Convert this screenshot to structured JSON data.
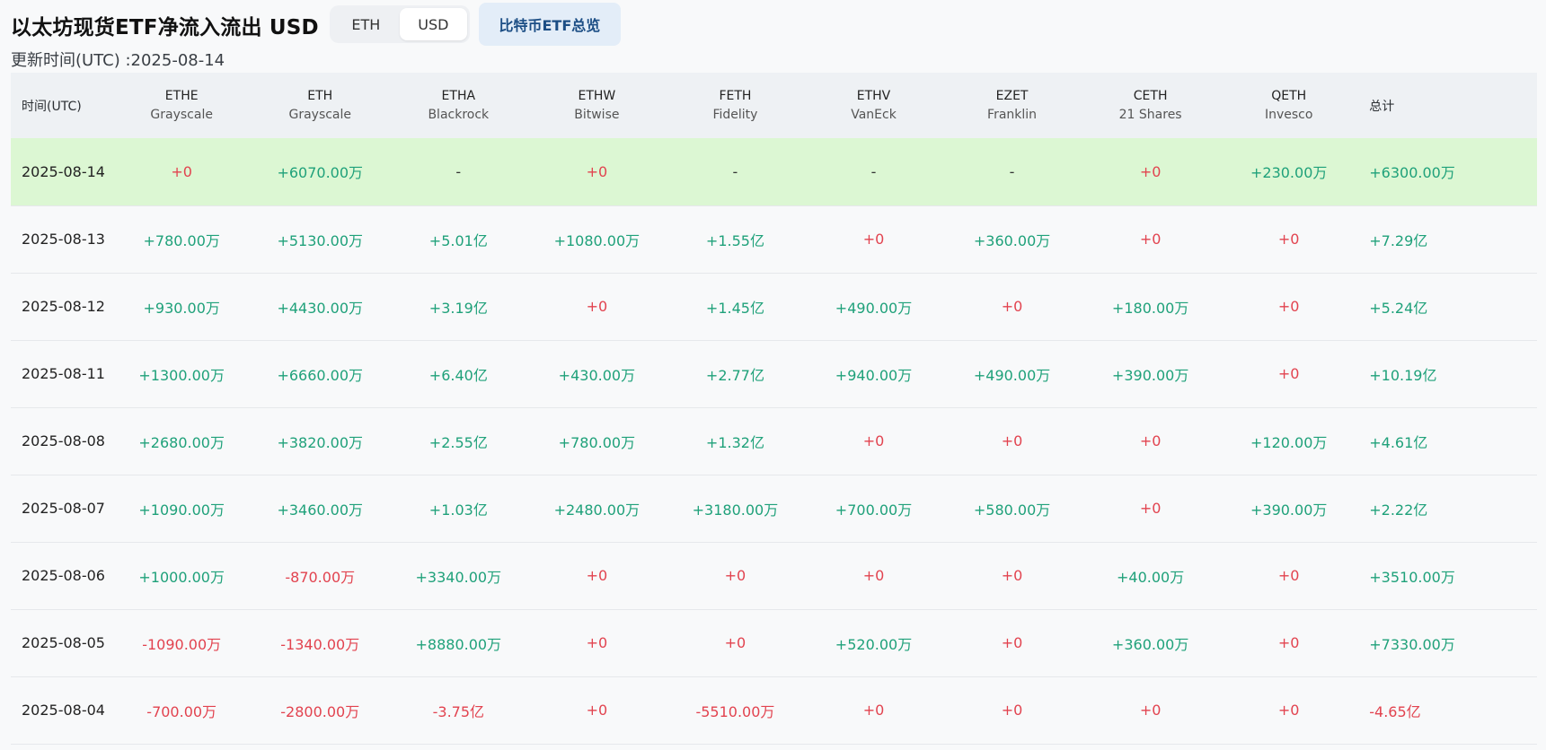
{
  "header": {
    "title": "以太坊现货ETF净流入流出 USD",
    "toggle": [
      "ETH",
      "USD"
    ],
    "active": "USD",
    "btc_overview_label": "比特币ETF总览"
  },
  "updated": "更新时间(UTC) :2025-08-14",
  "table": {
    "date_header": "时间(UTC)",
    "total_header": "总计",
    "columns": [
      {
        "code": "ETHE",
        "issuer": "Grayscale"
      },
      {
        "code": "ETH",
        "issuer": "Grayscale"
      },
      {
        "code": "ETHA",
        "issuer": "Blackrock"
      },
      {
        "code": "ETHW",
        "issuer": "Bitwise"
      },
      {
        "code": "FETH",
        "issuer": "Fidelity"
      },
      {
        "code": "ETHV",
        "issuer": "VanEck"
      },
      {
        "code": "EZET",
        "issuer": "Franklin"
      },
      {
        "code": "CETH",
        "issuer": "21 Shares"
      },
      {
        "code": "QETH",
        "issuer": "Invesco"
      }
    ],
    "rows": [
      {
        "date": "2025-08-14",
        "highlight": true,
        "values": [
          "+0",
          "+6070.00万",
          "-",
          "+0",
          "-",
          "-",
          "-",
          "+0",
          "+230.00万"
        ],
        "total": "+6300.00万"
      },
      {
        "date": "2025-08-13",
        "highlight": false,
        "values": [
          "+780.00万",
          "+5130.00万",
          "+5.01亿",
          "+1080.00万",
          "+1.55亿",
          "+0",
          "+360.00万",
          "+0",
          "+0"
        ],
        "total": "+7.29亿"
      },
      {
        "date": "2025-08-12",
        "highlight": false,
        "values": [
          "+930.00万",
          "+4430.00万",
          "+3.19亿",
          "+0",
          "+1.45亿",
          "+490.00万",
          "+0",
          "+180.00万",
          "+0"
        ],
        "total": "+5.24亿"
      },
      {
        "date": "2025-08-11",
        "highlight": false,
        "values": [
          "+1300.00万",
          "+6660.00万",
          "+6.40亿",
          "+430.00万",
          "+2.77亿",
          "+940.00万",
          "+490.00万",
          "+390.00万",
          "+0"
        ],
        "total": "+10.19亿"
      },
      {
        "date": "2025-08-08",
        "highlight": false,
        "values": [
          "+2680.00万",
          "+3820.00万",
          "+2.55亿",
          "+780.00万",
          "+1.32亿",
          "+0",
          "+0",
          "+0",
          "+120.00万"
        ],
        "total": "+4.61亿"
      },
      {
        "date": "2025-08-07",
        "highlight": false,
        "values": [
          "+1090.00万",
          "+3460.00万",
          "+1.03亿",
          "+2480.00万",
          "+3180.00万",
          "+700.00万",
          "+580.00万",
          "+0",
          "+390.00万"
        ],
        "total": "+2.22亿"
      },
      {
        "date": "2025-08-06",
        "highlight": false,
        "values": [
          "+1000.00万",
          "-870.00万",
          "+3340.00万",
          "+0",
          "+0",
          "+0",
          "+0",
          "+40.00万",
          "+0"
        ],
        "total": "+3510.00万"
      },
      {
        "date": "2025-08-05",
        "highlight": false,
        "values": [
          "-1090.00万",
          "-1340.00万",
          "+8880.00万",
          "+0",
          "+0",
          "+520.00万",
          "+0",
          "+360.00万",
          "+0"
        ],
        "total": "+7330.00万"
      },
      {
        "date": "2025-08-04",
        "highlight": false,
        "values": [
          "-700.00万",
          "-2800.00万",
          "-3.75亿",
          "+0",
          "-5510.00万",
          "+0",
          "+0",
          "+0",
          "+0"
        ],
        "total": "-4.65亿"
      }
    ]
  },
  "colors": {
    "positive": "#1fa17a",
    "negative": "#e2434f",
    "highlight_row": "#dcf7d3",
    "header_bg": "#eef1f4"
  }
}
